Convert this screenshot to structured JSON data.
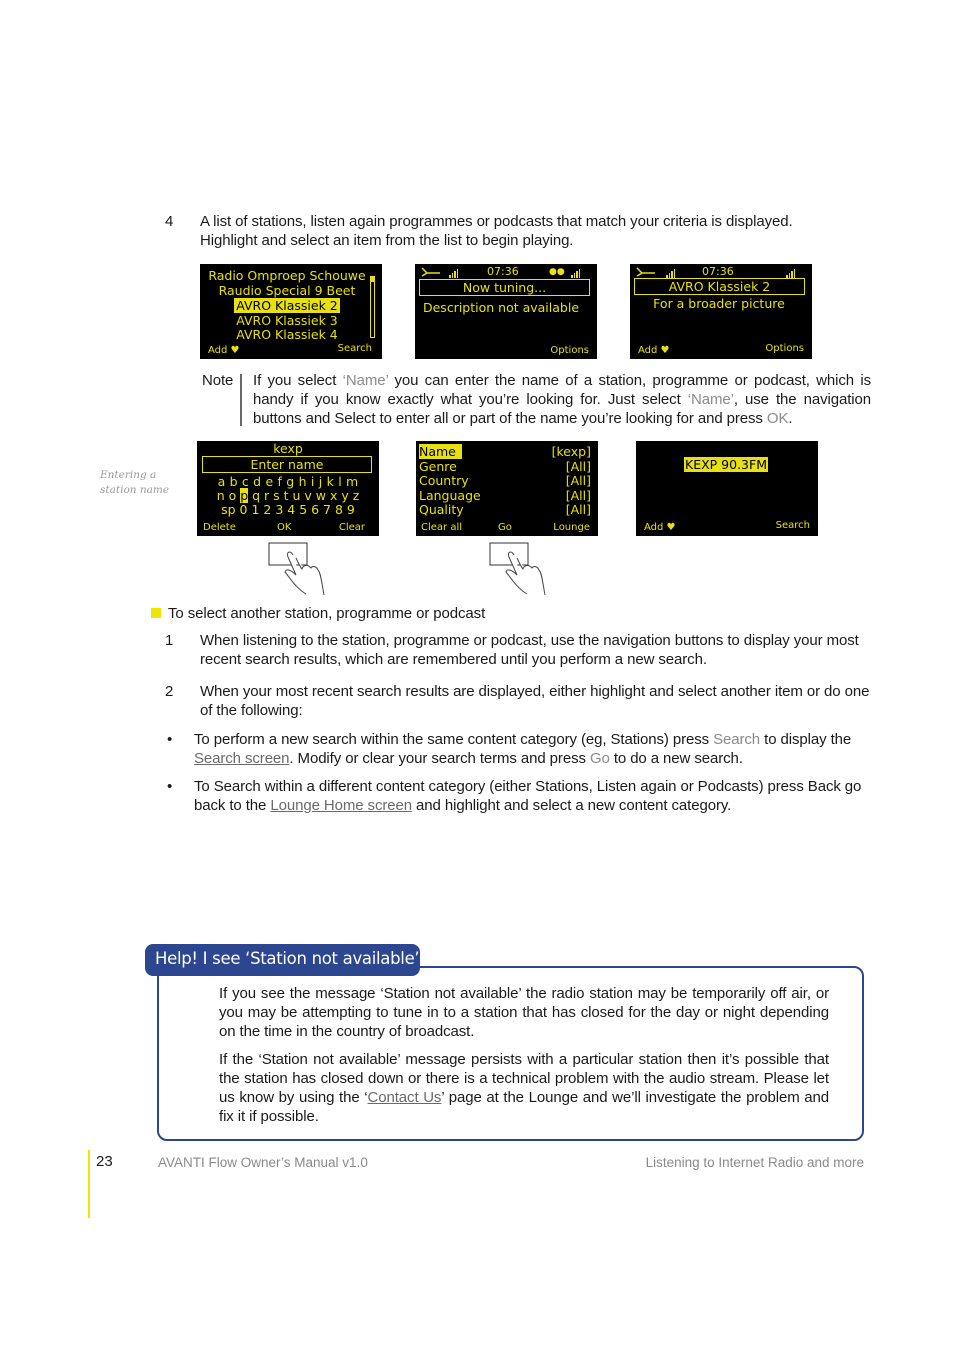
{
  "step4": {
    "number": "4",
    "text_line1": "A list of stations, listen again programmes or podcasts that match your criteria is displayed.",
    "text_line2": "Highlight and select an item from the list to begin playing."
  },
  "screens_row1": {
    "station_list": {
      "items": [
        "Radio Omproep Schouwe",
        "Raudio Special 9 Beet",
        "AVRO Klassiek 2",
        "AVRO Klassiek 3",
        "AVRO Klassiek 4"
      ],
      "selected_index": 2,
      "softkey_left": "Add ♥",
      "softkey_right": "Search",
      "scroll_position": 0
    },
    "now_tuning": {
      "time": "07:36",
      "title": "Now tuning...",
      "description": "Description not available",
      "softkey_right": "Options"
    },
    "now_playing": {
      "time": "07:36",
      "title": "AVRO Klassiek 2",
      "description": "For a broader picture",
      "softkey_left": "Add ♥",
      "softkey_right": "Options"
    }
  },
  "note": {
    "label": "Note",
    "text_a": "If you select ",
    "kw_name1": "‘Name’",
    "text_b": " you can enter the name of a station, programme or podcast, which is handy if you know exactly what you’re looking for. Just select ",
    "kw_name2": "‘Name’",
    "text_c": ", use the navigation buttons and Select to enter all or part of the name you’re looking for and press ",
    "kw_ok": "OK",
    "text_d": "."
  },
  "caption": {
    "line1": "Entering a",
    "line2": "station name"
  },
  "screens_row2": {
    "enter_name": {
      "entered": "kexp",
      "prompt": "Enter name",
      "row1": "a b c d e f g h i j k l m",
      "row2_pre": "n o ",
      "row2_sel": "p",
      "row2_post": " q r s t u v w x y z",
      "row3": "sp 0 1 2 3 4 5 6 7 8 9",
      "softkey_left": "Delete",
      "softkey_mid": "OK",
      "softkey_right": "Clear"
    },
    "search_criteria": {
      "rows": [
        {
          "label": "Name",
          "value": "[kexp]",
          "selected": true
        },
        {
          "label": "Genre",
          "value": "[All]"
        },
        {
          "label": "Country",
          "value": "[All]"
        },
        {
          "label": "Language",
          "value": "[All]"
        },
        {
          "label": "Quality",
          "value": "[All]"
        }
      ],
      "softkey_left": "Clear all",
      "softkey_mid": "Go",
      "softkey_right": "Lounge"
    },
    "result": {
      "item": "KEXP 90.3FM",
      "softkey_left": "Add ♥",
      "softkey_right": "Search"
    }
  },
  "section": {
    "heading": "To select another station, programme or podcast",
    "bullet_color": "#f0e400",
    "step1": {
      "number": "1",
      "text": "When listening to the station, programme or podcast, use the navigation buttons to display your most recent search results, which are remembered until you perform a new search."
    },
    "step2": {
      "number": "2",
      "text": "When your most recent search results are displayed, either highlight and select another item or do one of the following:"
    },
    "bullet1": {
      "a": "To perform a new search within the same content category (eg, Stations) press ",
      "kw_search": "Search",
      "b": " to display the ",
      "link_search_screen": "Search screen",
      "c": ". Modify or clear your search terms and press ",
      "kw_go": "Go",
      "d": " to do a new search."
    },
    "bullet2": {
      "a": "To Search within a different content category (either Stations, Listen again or Podcasts) press Back go back to the ",
      "link_lounge": "Lounge Home screen",
      "b": " and highlight and select a new content category."
    }
  },
  "help": {
    "title": "Help! I see ‘Station not available’",
    "accent_color": "#2c4690",
    "para1": "If you see the message ‘Station not available’ the radio station may be temporarily off air, or you may be attempting to tune in to a station that has closed for the day or night depending on the time in the country of broadcast.",
    "para2_a": "If the ‘Station not available’ message persists with a particular station then it’s possible that the station has closed down or there is a technical problem with the audio stream. Please let us know by using the ‘",
    "link_contact": "Contact Us",
    "para2_b": "’ page at the Lounge and we’ll investigate the problem and fix it if possible."
  },
  "footer": {
    "page_number": "23",
    "manual_title": "AVANTI Flow Owner’s Manual v1.0",
    "chapter": "Listening to Internet Radio and more"
  }
}
